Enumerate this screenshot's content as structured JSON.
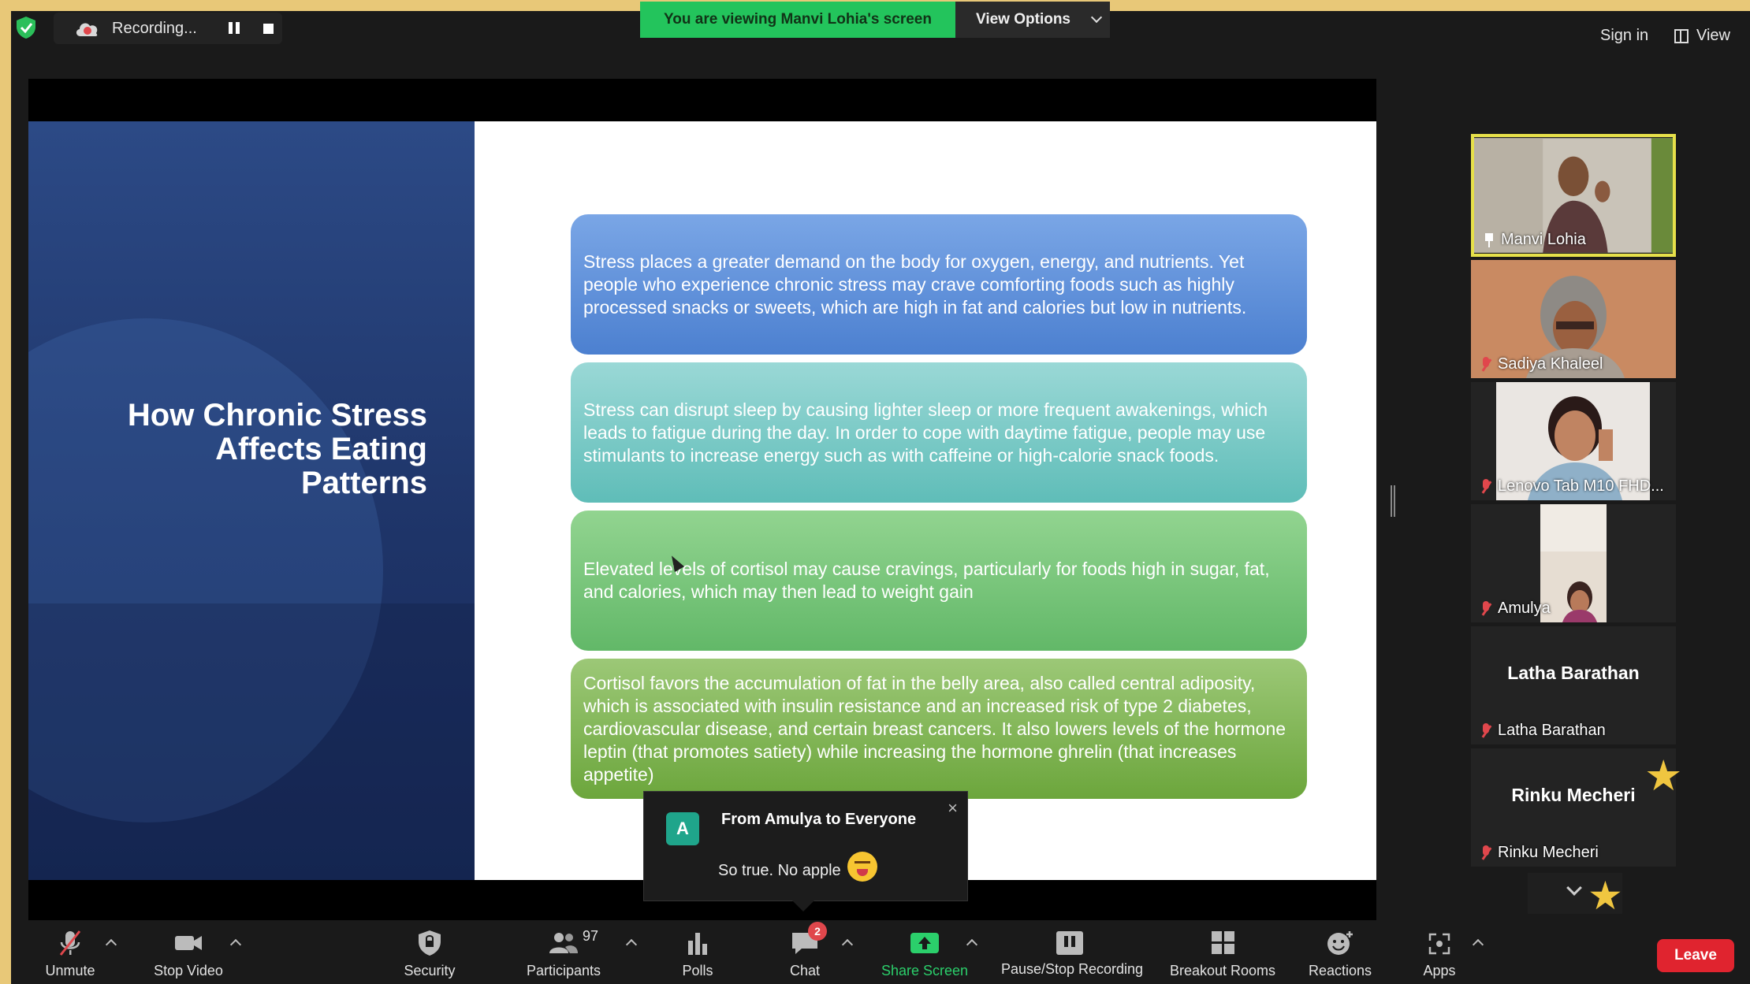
{
  "top_bar": {
    "recording_label": "Recording...",
    "viewing_banner": "You are viewing Manvi Lohia's screen",
    "view_options": "View Options",
    "sign_in": "Sign in",
    "view": "View"
  },
  "slide": {
    "title": "How Chronic Stress Affects Eating Patterns",
    "boxes": [
      "Stress places a greater demand on the body for oxygen, energy, and nutrients. Yet people who experience chronic stress may crave comforting foods such as highly processed snacks or sweets, which are high in fat and calories but low in nutrients.",
      "Stress can disrupt sleep by causing lighter sleep or more frequent awakenings, which leads to fatigue during the day. In order to cope with daytime fatigue, people may use stimulants to increase energy such as with caffeine or high-calorie snack foods.",
      "Elevated levels of cortisol may cause cravings, particularly for foods high in sugar, fat, and calories, which may then lead to weight gain",
      "Cortisol favors the accumulation of fat in the belly area, also called central adiposity, which is associated with insulin resistance and an increased risk of type 2 diabetes, cardiovascular disease, and certain breast cancers.  It also lowers levels of the hormone leptin (that promotes satiety) while increasing the hormone ghrelin (that increases appetite)"
    ]
  },
  "chat_popup": {
    "avatar_letter": "A",
    "from": "From Amulya to Everyone",
    "message": "So true. No apple",
    "close": "×"
  },
  "participants": [
    {
      "name": "Manvi Lohia"
    },
    {
      "name": "Sadiya Khaleel"
    },
    {
      "name": "Lenovo Tab M10 FHD..."
    },
    {
      "name": "Amulya"
    },
    {
      "name": "Latha Barathan",
      "center": "Latha Barathan"
    },
    {
      "name": "Rinku Mecheri",
      "center": "Rinku Mecheri"
    }
  ],
  "toolbar": {
    "unmute": "Unmute",
    "stop_video": "Stop Video",
    "security": "Security",
    "participants": "Participants",
    "participants_count": "97",
    "polls": "Polls",
    "chat": "Chat",
    "chat_badge": "2",
    "share_screen": "Share Screen",
    "pause_stop_recording": "Pause/Stop Recording",
    "breakout_rooms": "Breakout Rooms",
    "reactions": "Reactions",
    "apps": "Apps",
    "leave": "Leave"
  },
  "colors": {
    "accent_green": "#23c45c",
    "leave_red": "#e0242f",
    "active_speaker": "#e6e04a"
  }
}
